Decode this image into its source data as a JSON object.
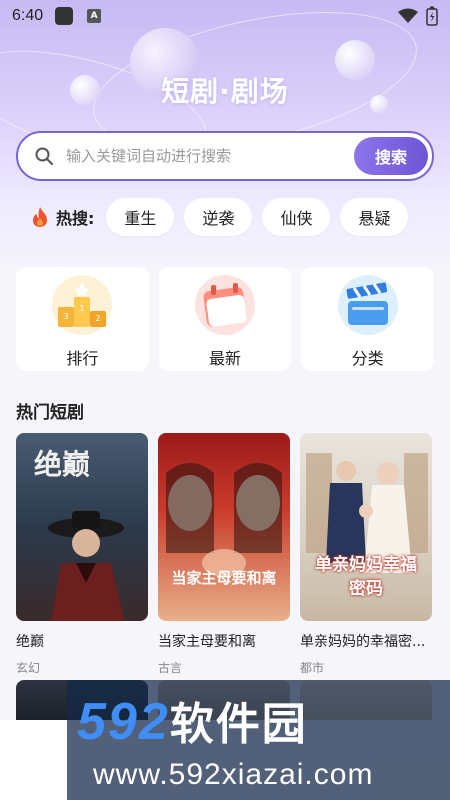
{
  "status_bar": {
    "time": "6:40",
    "a_badge": "A"
  },
  "header": {
    "title": "短剧·剧场"
  },
  "search": {
    "placeholder": "输入关键词自动进行搜索",
    "button_label": "搜索"
  },
  "hot_search": {
    "label": "热搜:",
    "tags": [
      "重生",
      "逆袭",
      "仙侠",
      "悬疑"
    ]
  },
  "categories": [
    {
      "label": "排行",
      "icon": "podium-icon"
    },
    {
      "label": "最新",
      "icon": "calendar-icon"
    },
    {
      "label": "分类",
      "icon": "clapperboard-icon"
    }
  ],
  "popular": {
    "section_title": "热门短剧",
    "items": [
      {
        "name": "绝巅",
        "genre": "玄幻",
        "poster_text": "绝巅"
      },
      {
        "name": "当家主母要和离",
        "genre": "古言",
        "poster_text": "当家主母要和离"
      },
      {
        "name": "单亲妈妈的幸福密...",
        "genre": "都市",
        "poster_text": "单亲妈妈幸福密码"
      }
    ]
  },
  "watermark": {
    "brand_num": "592",
    "brand_cn": "软件园",
    "url": "www.592xiazai.com"
  },
  "colors": {
    "accent": "#7a63d8",
    "hero_top": "#c7b9f3",
    "bg": "#f5f5fa"
  }
}
